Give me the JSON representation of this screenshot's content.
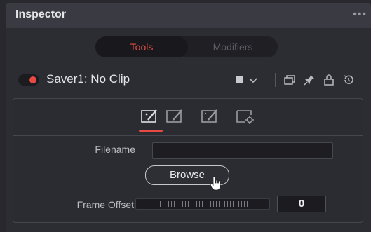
{
  "panel": {
    "title": "Inspector",
    "menu_glyph": "•••"
  },
  "tabs": [
    {
      "label": "Tools",
      "active": true
    },
    {
      "label": "Modifiers",
      "active": false
    }
  ],
  "tool": {
    "enabled": true,
    "name": "Saver1: No Clip",
    "icons": [
      "color-swatch-icon",
      "chevron-down-icon",
      "windows-icon",
      "pin-icon",
      "lock-icon",
      "reset-icon"
    ]
  },
  "subtabs": [
    "brush-settings-icon",
    "brush-icon",
    "brush-alt-icon",
    "settings-page-icon"
  ],
  "controls": {
    "filename_label": "Filename",
    "filename_value": "",
    "browse_label": "Browse",
    "frame_offset_label": "Frame Offset",
    "frame_offset_value": "0"
  },
  "colors": {
    "accent": "#e84a43",
    "panel_bg": "#28282e",
    "header_bg": "#3a3a42"
  }
}
